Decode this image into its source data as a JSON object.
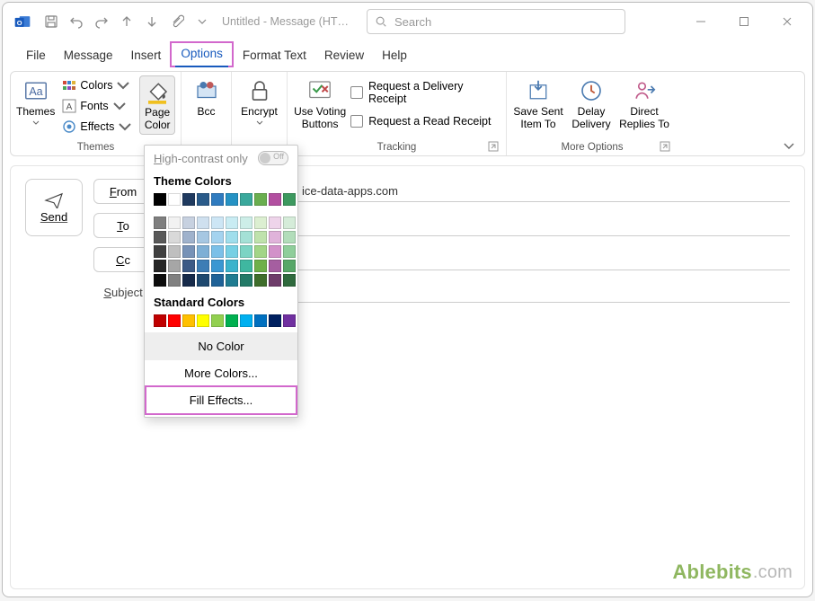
{
  "titlebar": {
    "doc_title": "Untitled - Message (HT…",
    "search_placeholder": "Search"
  },
  "tabs": {
    "file": "File",
    "message": "Message",
    "insert": "Insert",
    "options": "Options",
    "format_text": "Format Text",
    "review": "Review",
    "help": "Help"
  },
  "ribbon": {
    "themes_group": {
      "label": "Themes",
      "themes": "Themes",
      "colors": "Colors",
      "fonts": "Fonts",
      "effects": "Effects",
      "page_color": "Page\nColor"
    },
    "bcc": "Bcc",
    "encrypt": "Encrypt",
    "tracking_group": {
      "label": "Tracking",
      "voting": "Use Voting\nButtons",
      "delivery": "Request a Delivery Receipt",
      "read": "Request a Read Receipt"
    },
    "more_group": {
      "label": "More Options",
      "save_sent": "Save Sent\nItem To",
      "delay": "Delay\nDelivery",
      "direct": "Direct\nReplies To"
    }
  },
  "compose": {
    "send": "Send",
    "from": "From",
    "to": "To",
    "cc": "Cc",
    "subject": "Subject",
    "from_value_tail": "ice-data-apps.com"
  },
  "dropdown": {
    "high_contrast": "High-contrast only",
    "toggle_off": "Off",
    "theme_colors": "Theme Colors",
    "standard_colors": "Standard Colors",
    "no_color": "No Color",
    "more_colors": "More Colors...",
    "fill_effects": "Fill Effects...",
    "theme_row1": [
      "#000000",
      "#ffffff",
      "#1f3a5f",
      "#2a5b8a",
      "#2f7bbf",
      "#2592c4",
      "#3aa89c",
      "#6aae4f",
      "#b24fa0",
      "#3d995f"
    ],
    "theme_shades": [
      [
        "#7f7f7f",
        "#f2f2f2",
        "#c7d1e0",
        "#cfe0ef",
        "#cde6f5",
        "#c9ecf3",
        "#cdeee8",
        "#dcefd1",
        "#eed4ea",
        "#d5ecd9"
      ],
      [
        "#595959",
        "#d9d9d9",
        "#9fb2cc",
        "#a6c7e2",
        "#a4d3ef",
        "#9fdeec",
        "#a4e1d6",
        "#bfe2ac",
        "#e0b3da",
        "#b2ddba"
      ],
      [
        "#404040",
        "#bfbfbf",
        "#7792b7",
        "#7eafd5",
        "#7bc0e8",
        "#76d0e4",
        "#7bd4c4",
        "#a2d587",
        "#d291c9",
        "#8fce9b"
      ],
      [
        "#262626",
        "#a6a6a6",
        "#3c5a86",
        "#3d7db5",
        "#3a97d2",
        "#3bb3cc",
        "#3fb7a0",
        "#6fb04a",
        "#a55ea0",
        "#57a768"
      ],
      [
        "#0d0d0d",
        "#808080",
        "#162a4a",
        "#1e486f",
        "#1f6297",
        "#1f7c91",
        "#237a67",
        "#3f6e2b",
        "#6e3c6a",
        "#2f6a3d"
      ]
    ],
    "standard_row": [
      "#c00000",
      "#ff0000",
      "#ffc000",
      "#ffff00",
      "#92d050",
      "#00b050",
      "#00b0f0",
      "#0070c0",
      "#002060",
      "#7030a0"
    ]
  },
  "watermark": {
    "brand": "Ablebits",
    "domain": ".com"
  }
}
